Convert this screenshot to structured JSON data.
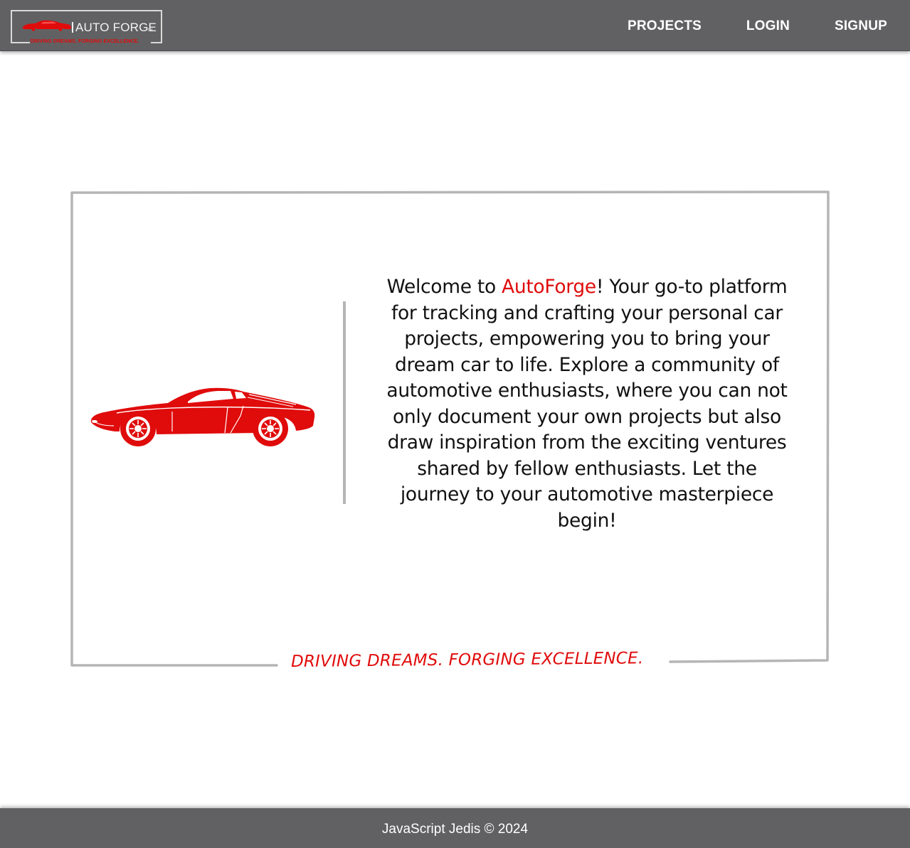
{
  "header": {
    "logo_text": "AUTO FORGE",
    "logo_tm": "TM",
    "logo_tagline": "DRIVING DREAMS. FORGING EXCELLENCE.",
    "nav": [
      {
        "label": "PROJECTS"
      },
      {
        "label": "LOGIN"
      },
      {
        "label": "SIGNUP"
      }
    ]
  },
  "hero": {
    "welcome_prefix": "Welcome to ",
    "brand_name": "AutoForge",
    "welcome_body": "! Your go-to platform for tracking and crafting your personal car projects, empowering you to bring your dream car to life. Explore a community of automotive enthusiasts, where you can not only document your own projects but also draw inspiration from the exciting ventures shared by fellow enthusiasts. Let the journey to your automotive masterpiece begin!",
    "slogan": "DRIVING DREAMS. FORGING EXCELLENCE."
  },
  "footer": {
    "text": "JavaScript Jedis © 2024"
  },
  "colors": {
    "header_bg": "#616163",
    "accent_red": "#e00b0b",
    "frame_gray": "#b5b5b5"
  }
}
